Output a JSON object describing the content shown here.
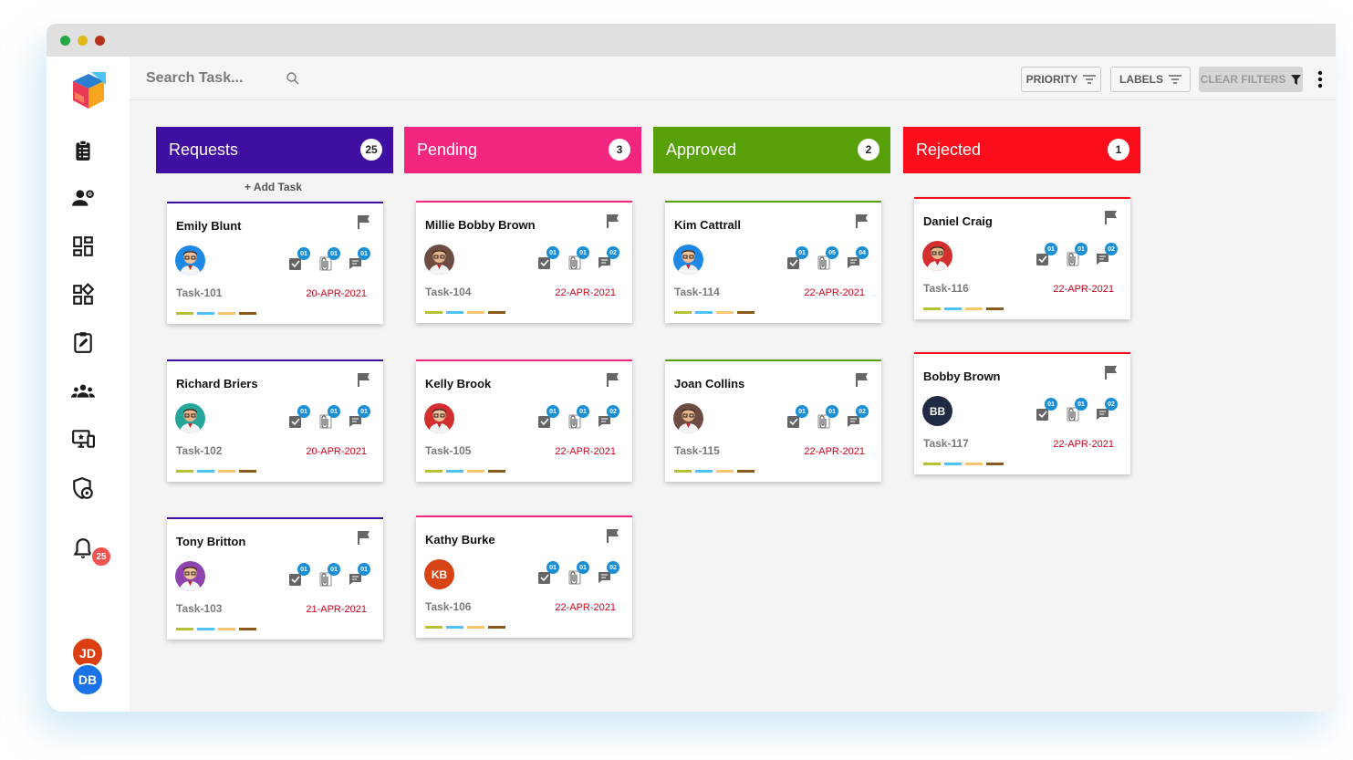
{
  "topbar": {
    "search_placeholder": "Search Task...",
    "priority_label": "PRIORITY",
    "labels_label": "LABELS",
    "clear_filters_label": "CLEAR FILTERS"
  },
  "sidebar": {
    "notification_count": "25",
    "users": [
      "JD",
      "DB"
    ]
  },
  "add_task_label": "+ Add Task",
  "label_colors": [
    "#b5c233",
    "#4fc3f7",
    "#f8c471",
    "#8b5a1b"
  ],
  "columns": [
    {
      "title": "Requests",
      "count": "25",
      "color": "#3f0ea3",
      "cards": [
        {
          "name": "Emily Blunt",
          "id": "Task-101",
          "date": "20-APR-2021",
          "counts": [
            "01",
            "01",
            "01"
          ]
        },
        {
          "name": "Richard Briers",
          "id": "Task-102",
          "date": "20-APR-2021",
          "counts": [
            "01",
            "01",
            "01"
          ]
        },
        {
          "name": "Tony Britton",
          "id": "Task-103",
          "date": "21-APR-2021",
          "counts": [
            "01",
            "01",
            "01"
          ]
        }
      ]
    },
    {
      "title": "Pending",
      "count": "3",
      "color": "#f2267f",
      "cards": [
        {
          "name": "Millie Bobby Brown",
          "id": "Task-104",
          "date": "22-APR-2021",
          "counts": [
            "01",
            "01",
            "02"
          ]
        },
        {
          "name": "Kelly Brook",
          "id": "Task-105",
          "date": "22-APR-2021",
          "counts": [
            "01",
            "01",
            "02"
          ]
        },
        {
          "name": "Kathy Burke",
          "id": "Task-106",
          "date": "22-APR-2021",
          "counts": [
            "01",
            "01",
            "02"
          ],
          "initials": "KB"
        }
      ]
    },
    {
      "title": "Approved",
      "count": "2",
      "color": "#58a00a",
      "cards": [
        {
          "name": "Kim Cattrall",
          "id": "Task-114",
          "date": "22-APR-2021",
          "counts": [
            "01",
            "05",
            "04"
          ]
        },
        {
          "name": "Joan Collins",
          "id": "Task-115",
          "date": "22-APR-2021",
          "counts": [
            "01",
            "01",
            "02"
          ]
        }
      ]
    },
    {
      "title": "Rejected",
      "count": "1",
      "color": "#fb0d1b",
      "cards": [
        {
          "name": "Daniel Craig",
          "id": "Task-116",
          "date": "22-APR-2021",
          "counts": [
            "01",
            "01",
            "02"
          ]
        },
        {
          "name": "Bobby Brown",
          "id": "Task-117",
          "date": "22-APR-2021",
          "counts": [
            "01",
            "01",
            "02"
          ],
          "initials": "BB"
        }
      ]
    }
  ]
}
